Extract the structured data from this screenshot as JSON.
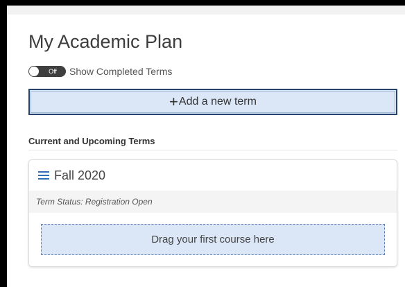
{
  "page": {
    "title": "My Academic Plan"
  },
  "toggle": {
    "state_text": "Off",
    "label": "Show Completed Terms",
    "checked": false
  },
  "add_term": {
    "icon": "plus-icon",
    "icon_glyph": "+",
    "label": "Add a new term"
  },
  "section": {
    "heading": "Current and Upcoming Terms"
  },
  "terms": [
    {
      "drag_icon": "menu-icon",
      "name": "Fall 2020",
      "status": "Term Status: Registration Open",
      "dropzone": "Drag your first course here"
    }
  ],
  "colors": {
    "accent_blue": "#2f6db5",
    "button_bg": "#dbe7f7",
    "button_border": "#27436b",
    "toggle_bg": "#3f3f3f"
  }
}
